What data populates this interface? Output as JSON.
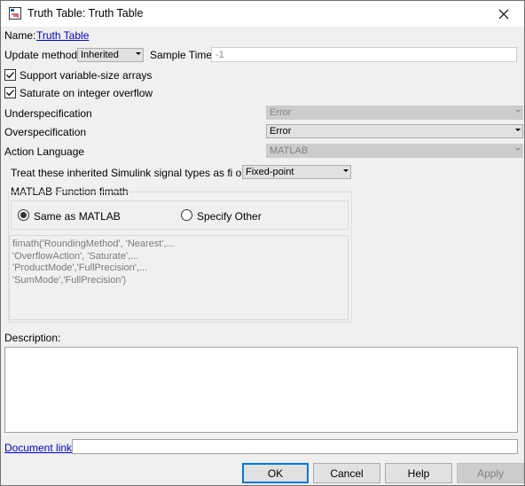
{
  "window": {
    "title": "Truth Table: Truth Table",
    "icon": "truth-table-app-icon",
    "close_icon": "close-icon"
  },
  "name": {
    "label": "Name:",
    "value": "Truth Table"
  },
  "update_method": {
    "label": "Update method:",
    "value": "Inherited"
  },
  "sample_time": {
    "label": "Sample Time:",
    "value": "-1"
  },
  "checkboxes": [
    {
      "label": "Support variable-size arrays",
      "checked": true
    },
    {
      "label": "Saturate on integer overflow",
      "checked": true
    }
  ],
  "underspecification": {
    "label": "Underspecification",
    "value": "Error",
    "enabled": false
  },
  "overspecification": {
    "label": "Overspecification",
    "value": "Error",
    "enabled": true
  },
  "action_language": {
    "label": "Action Language",
    "value": "MATLAB",
    "enabled": false
  },
  "treat_inherited": {
    "label": "Treat these inherited Simulink signal types as fi objects",
    "value": "Fixed-point"
  },
  "fimath": {
    "group_label": "MATLAB Function fimath",
    "options": [
      {
        "label": "Same as MATLAB",
        "selected": true
      },
      {
        "label": "Specify Other",
        "selected": false
      }
    ],
    "text_lines": [
      "fimath('RoundingMethod', 'Nearest',...",
      "'OverflowAction', 'Saturate',...",
      "'ProductMode','FullPrecision',...",
      "'SumMode','FullPrecision')"
    ]
  },
  "description": {
    "label": "Description:",
    "value": ""
  },
  "document_link": {
    "label": "Document link:",
    "value": ""
  },
  "buttons": {
    "ok": "OK",
    "cancel": "Cancel",
    "help": "Help",
    "apply": "Apply"
  },
  "colors": {
    "link": "#0000cc",
    "default_button_border": "#0078d7",
    "window_bg": "#f0f0f0"
  }
}
